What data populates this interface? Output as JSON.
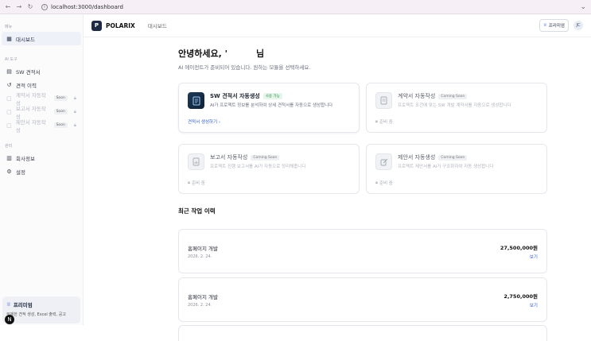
{
  "browser": {
    "url": "localhost:3000/dashboard"
  },
  "sidebar": {
    "section_menu": "메뉴",
    "dashboard": "대시보드",
    "section_ai": "AI 도구",
    "ai_items": [
      {
        "label": "SW 견적서",
        "disabled": false
      },
      {
        "label": "견적 이력",
        "disabled": false
      },
      {
        "label": "계약서 자동작성",
        "soon": "Soon",
        "disabled": true
      },
      {
        "label": "보고서 자동작성",
        "soon": "Soon",
        "disabled": true
      },
      {
        "label": "제안서 자동작성",
        "soon": "Soon",
        "disabled": true
      }
    ],
    "section_manage": "관리",
    "manage_items": [
      "회사정보",
      "설정"
    ],
    "promo_title": "프리미엄",
    "promo_desc": "무제한 견적 생성, Excel 출력, 공고",
    "n_badge": "N"
  },
  "topbar": {
    "brand_letter": "P",
    "brand": "POLARIX",
    "crumb": "대시보드",
    "premium": "프리미엄",
    "avatar": "JC"
  },
  "content": {
    "greeting_prefix": "안녕하세요, '",
    "greeting_suffix": "님",
    "subtitle": "AI 에이전트가 준비되어 있습니다. 원하는 모듈을 선택하세요.",
    "cards": [
      {
        "title": "SW 견적서 자동생성",
        "badge": "사용 가능",
        "desc": "AI가 프로젝트 정보를 분석하여 상세 견적서를 자동으로 생성합니다",
        "action": "견적서 생성하기 ›"
      },
      {
        "title": "계약서 자동작성",
        "badge": "Coming Soon",
        "desc": "프로젝트 조건에 맞는 SW 개발 계약서를 자동으로 생성합니다",
        "action": "준비 중"
      },
      {
        "title": "보고서 자동작성",
        "badge": "Coming Soon",
        "desc": "프로젝트 진행 보고서를 AI가 자동으로 정리해줍니다",
        "action": "준비 중"
      },
      {
        "title": "제안서 자동생성",
        "badge": "Coming Soon",
        "desc": "프로젝트 제안서를 AI가 구조화하여 자동 생성합니다",
        "action": "준비 중"
      }
    ],
    "recent_title": "최근 작업 이력",
    "recent": [
      {
        "name": "홈페이지 개발",
        "date": "2026. 2. 24.",
        "amount": "27,500,000원",
        "view": "보기"
      },
      {
        "name": "홈페이지 개발",
        "date": "2026. 2. 24.",
        "amount": "2,750,000원",
        "view": "보기"
      }
    ]
  }
}
